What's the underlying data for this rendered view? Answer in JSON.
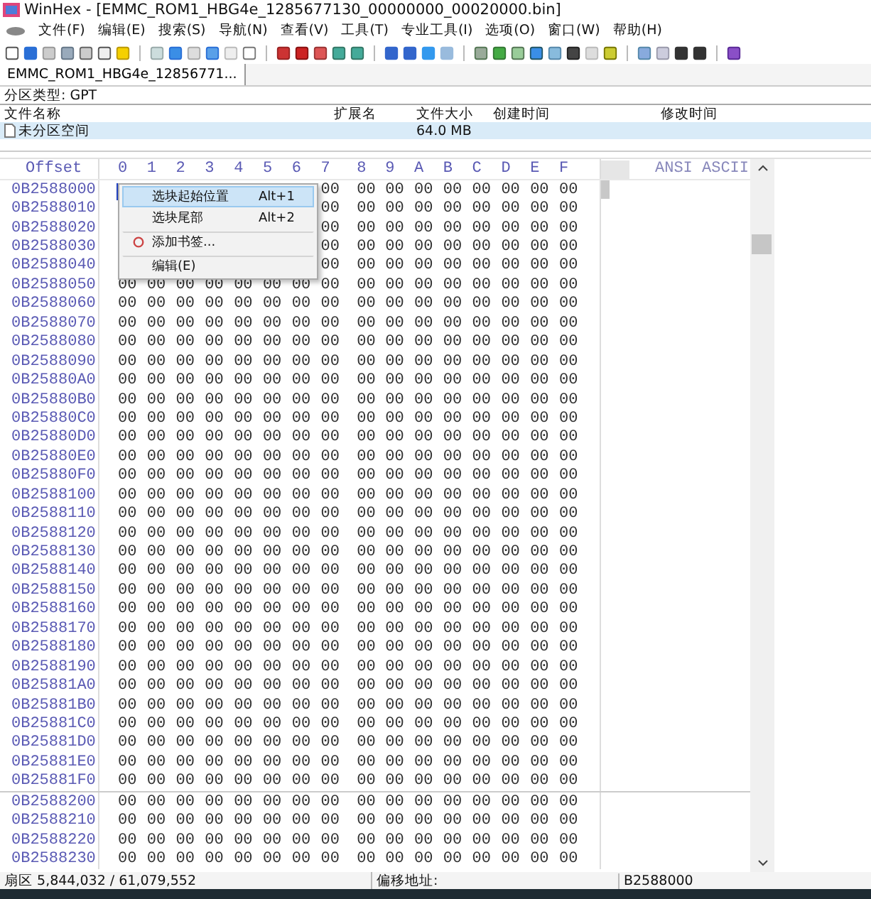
{
  "window": {
    "title": "WinHex - [EMMC_ROM1_HBG4e_1285677130_00000000_00020000.bin]"
  },
  "menu_bar": [
    "文件(F)",
    "编辑(E)",
    "搜索(S)",
    "导航(N)",
    "查看(V)",
    "工具(T)",
    "专业工具(I)",
    "选项(O)",
    "窗口(W)",
    "帮助(H)"
  ],
  "tabs": [
    {
      "label": "EMMC_ROM1_HBG4e_12856771..."
    }
  ],
  "partition_type": "分区类型: GPT",
  "file_list": {
    "columns": [
      "文件名称",
      "扩展名",
      "文件大小",
      "创建时间",
      "修改时间"
    ],
    "rows": [
      {
        "name": "未分区空间",
        "extension": "",
        "size": "64.0 MB",
        "selected": true
      }
    ]
  },
  "hex_view": {
    "offset_header": "Offset",
    "column_headers": [
      "0",
      "1",
      "2",
      "3",
      "4",
      "5",
      "6",
      "7",
      "8",
      "9",
      "A",
      "B",
      "C",
      "D",
      "E",
      "F"
    ],
    "text_header": "ANSI ASCII",
    "rows": [
      {
        "offset": "0B2588000",
        "bytes": [
          "00",
          "00",
          "00",
          "00",
          "00",
          "00",
          "00",
          "00",
          "00"
        ]
      },
      {
        "offset": "0B2588010",
        "bytes": [
          "00",
          "00",
          "00",
          "00",
          "00",
          "00",
          "00",
          "00",
          "00"
        ]
      },
      {
        "offset": "0B2588020",
        "bytes": [
          "00",
          "00",
          "00",
          "00",
          "00",
          "00",
          "00",
          "00",
          "00"
        ]
      },
      {
        "offset": "0B2588030",
        "bytes": [
          "00",
          "00",
          "00",
          "00",
          "00",
          "00",
          "00",
          "00",
          "00"
        ]
      },
      {
        "offset": "0B2588040",
        "bytes": [
          "00",
          "00",
          "00",
          "00",
          "00",
          "00",
          "00",
          "00",
          "00"
        ]
      },
      {
        "offset": "0B2588050",
        "bytes": [
          "00",
          "00",
          "00",
          "00",
          "00",
          "00",
          "00",
          "00",
          "00",
          "00",
          "00",
          "00",
          "00",
          "00",
          "00",
          "00"
        ]
      },
      {
        "offset": "0B2588060",
        "bytes": [
          "00",
          "00",
          "00",
          "00",
          "00",
          "00",
          "00",
          "00",
          "00",
          "00",
          "00",
          "00",
          "00",
          "00",
          "00",
          "00"
        ]
      },
      {
        "offset": "0B2588070",
        "bytes": [
          "00",
          "00",
          "00",
          "00",
          "00",
          "00",
          "00",
          "00",
          "00",
          "00",
          "00",
          "00",
          "00",
          "00",
          "00",
          "00"
        ]
      },
      {
        "offset": "0B2588080",
        "bytes": [
          "00",
          "00",
          "00",
          "00",
          "00",
          "00",
          "00",
          "00",
          "00",
          "00",
          "00",
          "00",
          "00",
          "00",
          "00",
          "00"
        ]
      },
      {
        "offset": "0B2588090",
        "bytes": [
          "00",
          "00",
          "00",
          "00",
          "00",
          "00",
          "00",
          "00",
          "00",
          "00",
          "00",
          "00",
          "00",
          "00",
          "00",
          "00"
        ]
      },
      {
        "offset": "0B25880A0",
        "bytes": [
          "00",
          "00",
          "00",
          "00",
          "00",
          "00",
          "00",
          "00",
          "00",
          "00",
          "00",
          "00",
          "00",
          "00",
          "00",
          "00"
        ]
      },
      {
        "offset": "0B25880B0",
        "bytes": [
          "00",
          "00",
          "00",
          "00",
          "00",
          "00",
          "00",
          "00",
          "00",
          "00",
          "00",
          "00",
          "00",
          "00",
          "00",
          "00"
        ]
      },
      {
        "offset": "0B25880C0",
        "bytes": [
          "00",
          "00",
          "00",
          "00",
          "00",
          "00",
          "00",
          "00",
          "00",
          "00",
          "00",
          "00",
          "00",
          "00",
          "00",
          "00"
        ]
      },
      {
        "offset": "0B25880D0",
        "bytes": [
          "00",
          "00",
          "00",
          "00",
          "00",
          "00",
          "00",
          "00",
          "00",
          "00",
          "00",
          "00",
          "00",
          "00",
          "00",
          "00"
        ]
      },
      {
        "offset": "0B25880E0",
        "bytes": [
          "00",
          "00",
          "00",
          "00",
          "00",
          "00",
          "00",
          "00",
          "00",
          "00",
          "00",
          "00",
          "00",
          "00",
          "00",
          "00"
        ]
      },
      {
        "offset": "0B25880F0",
        "bytes": [
          "00",
          "00",
          "00",
          "00",
          "00",
          "00",
          "00",
          "00",
          "00",
          "00",
          "00",
          "00",
          "00",
          "00",
          "00",
          "00"
        ]
      },
      {
        "offset": "0B2588100",
        "bytes": [
          "00",
          "00",
          "00",
          "00",
          "00",
          "00",
          "00",
          "00",
          "00",
          "00",
          "00",
          "00",
          "00",
          "00",
          "00",
          "00"
        ]
      },
      {
        "offset": "0B2588110",
        "bytes": [
          "00",
          "00",
          "00",
          "00",
          "00",
          "00",
          "00",
          "00",
          "00",
          "00",
          "00",
          "00",
          "00",
          "00",
          "00",
          "00"
        ]
      },
      {
        "offset": "0B2588120",
        "bytes": [
          "00",
          "00",
          "00",
          "00",
          "00",
          "00",
          "00",
          "00",
          "00",
          "00",
          "00",
          "00",
          "00",
          "00",
          "00",
          "00"
        ]
      },
      {
        "offset": "0B2588130",
        "bytes": [
          "00",
          "00",
          "00",
          "00",
          "00",
          "00",
          "00",
          "00",
          "00",
          "00",
          "00",
          "00",
          "00",
          "00",
          "00",
          "00"
        ]
      },
      {
        "offset": "0B2588140",
        "bytes": [
          "00",
          "00",
          "00",
          "00",
          "00",
          "00",
          "00",
          "00",
          "00",
          "00",
          "00",
          "00",
          "00",
          "00",
          "00",
          "00"
        ]
      },
      {
        "offset": "0B2588150",
        "bytes": [
          "00",
          "00",
          "00",
          "00",
          "00",
          "00",
          "00",
          "00",
          "00",
          "00",
          "00",
          "00",
          "00",
          "00",
          "00",
          "00"
        ]
      },
      {
        "offset": "0B2588160",
        "bytes": [
          "00",
          "00",
          "00",
          "00",
          "00",
          "00",
          "00",
          "00",
          "00",
          "00",
          "00",
          "00",
          "00",
          "00",
          "00",
          "00"
        ]
      },
      {
        "offset": "0B2588170",
        "bytes": [
          "00",
          "00",
          "00",
          "00",
          "00",
          "00",
          "00",
          "00",
          "00",
          "00",
          "00",
          "00",
          "00",
          "00",
          "00",
          "00"
        ]
      },
      {
        "offset": "0B2588180",
        "bytes": [
          "00",
          "00",
          "00",
          "00",
          "00",
          "00",
          "00",
          "00",
          "00",
          "00",
          "00",
          "00",
          "00",
          "00",
          "00",
          "00"
        ]
      },
      {
        "offset": "0B2588190",
        "bytes": [
          "00",
          "00",
          "00",
          "00",
          "00",
          "00",
          "00",
          "00",
          "00",
          "00",
          "00",
          "00",
          "00",
          "00",
          "00",
          "00"
        ]
      },
      {
        "offset": "0B25881A0",
        "bytes": [
          "00",
          "00",
          "00",
          "00",
          "00",
          "00",
          "00",
          "00",
          "00",
          "00",
          "00",
          "00",
          "00",
          "00",
          "00",
          "00"
        ]
      },
      {
        "offset": "0B25881B0",
        "bytes": [
          "00",
          "00",
          "00",
          "00",
          "00",
          "00",
          "00",
          "00",
          "00",
          "00",
          "00",
          "00",
          "00",
          "00",
          "00",
          "00"
        ]
      },
      {
        "offset": "0B25881C0",
        "bytes": [
          "00",
          "00",
          "00",
          "00",
          "00",
          "00",
          "00",
          "00",
          "00",
          "00",
          "00",
          "00",
          "00",
          "00",
          "00",
          "00"
        ]
      },
      {
        "offset": "0B25881D0",
        "bytes": [
          "00",
          "00",
          "00",
          "00",
          "00",
          "00",
          "00",
          "00",
          "00",
          "00",
          "00",
          "00",
          "00",
          "00",
          "00",
          "00"
        ]
      },
      {
        "offset": "0B25881E0",
        "bytes": [
          "00",
          "00",
          "00",
          "00",
          "00",
          "00",
          "00",
          "00",
          "00",
          "00",
          "00",
          "00",
          "00",
          "00",
          "00",
          "00"
        ]
      },
      {
        "offset": "0B25881F0",
        "bytes": [
          "00",
          "00",
          "00",
          "00",
          "00",
          "00",
          "00",
          "00",
          "00",
          "00",
          "00",
          "00",
          "00",
          "00",
          "00",
          "00"
        ]
      },
      {
        "offset": "0B2588200",
        "bytes": [
          "00",
          "00",
          "00",
          "00",
          "00",
          "00",
          "00",
          "00",
          "00",
          "00",
          "00",
          "00",
          "00",
          "00",
          "00",
          "00"
        ]
      },
      {
        "offset": "0B2588210",
        "bytes": [
          "00",
          "00",
          "00",
          "00",
          "00",
          "00",
          "00",
          "00",
          "00",
          "00",
          "00",
          "00",
          "00",
          "00",
          "00",
          "00"
        ]
      },
      {
        "offset": "0B2588220",
        "bytes": [
          "00",
          "00",
          "00",
          "00",
          "00",
          "00",
          "00",
          "00",
          "00",
          "00",
          "00",
          "00",
          "00",
          "00",
          "00",
          "00"
        ]
      },
      {
        "offset": "0B2588230",
        "bytes": [
          "00",
          "00",
          "00",
          "00",
          "00",
          "00",
          "00",
          "00",
          "00",
          "00",
          "00",
          "00",
          "00",
          "00",
          "00",
          "00"
        ]
      }
    ]
  },
  "context_menu": [
    {
      "label": "选块起始位置",
      "shortcut": "Alt+1",
      "selected": true,
      "kind": "plain",
      "separator_before": false
    },
    {
      "label": "选块尾部",
      "shortcut": "Alt+2",
      "selected": false,
      "kind": "plain",
      "separator_before": false
    },
    {
      "label": "添加书签...",
      "selected": false,
      "kind": "bookmark",
      "separator_before": true
    },
    {
      "label": "编辑(E)",
      "selected": false,
      "kind": "plain",
      "separator_before": true
    }
  ],
  "status_bar": {
    "sector": "扇区 5,844,032 / 61,079,552",
    "offset_label": "偏移地址:",
    "offset_value": "B2588000"
  }
}
